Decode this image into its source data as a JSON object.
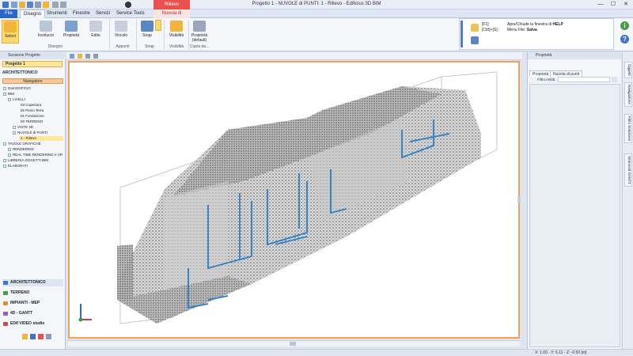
{
  "window": {
    "title": "Progetto 1 - NUVOLE di PUNTI: 1 - Rilievo - Edificius 3D BIM",
    "context_tab_group": "Rilievo",
    "minimize": "—",
    "maximize": "☐",
    "close": "✕"
  },
  "tabs": [
    "File",
    "Disegno",
    "Strumenti",
    "Finestre",
    "Servizi",
    "Service Tools",
    "Nuvola di punti"
  ],
  "ribbon": {
    "select": "Select",
    "involucro": "Involucro",
    "proprieta": "Proprietà",
    "edito": "Edito",
    "vincolo": "Vincolo",
    "snap": "Snap",
    "visibilita": "Visibilità",
    "proprieta_default": "Proprietà (default)",
    "groups": [
      "Disegno",
      "Appunti",
      "Snap",
      "Visibilità",
      "Copia da..."
    ]
  },
  "help": {
    "f1_key": "[F1]",
    "f1_text": "Apre/Chiude la finestra di",
    "f1_bold": "HELP",
    "ctrl_key": "[Ctrl]+[S]",
    "ctrl_text": "Menu File:",
    "ctrl_bold": "Salva"
  },
  "left_panel": {
    "header": "Sessione Progetto",
    "project": "Progetto 1",
    "section": "ARCHITETTONICO",
    "navigator": "Navigatore",
    "tree": [
      "Dati EDIFICIO",
      "BIM",
      "LIVELLI",
      "03 Copertura",
      "02 Piano Terra",
      "01 Fondazione",
      "00 TERRENO",
      "VISTE 3D",
      "NUVOLE di PUNTI",
      "1 - Rilievo",
      "TAVOLE GRAFICHE",
      "RENDERING",
      "REAL TIME RENDERING e VR",
      "LIBRERIA OGGETTI BIM",
      "ELABORATI"
    ],
    "bottom_menu": [
      {
        "label": "ARCHITETTONICO",
        "color": "#3f74c9"
      },
      {
        "label": "TERRENO",
        "color": "#4a9b4a"
      },
      {
        "label": "IMPIANTI - MEP",
        "color": "#d98e2f"
      },
      {
        "label": "4D - GANTT",
        "color": "#9a5bb7"
      },
      {
        "label": "EDIf VIDEO studio",
        "color": "#c84b4b"
      }
    ]
  },
  "right_panel": {
    "header": "Proprietà",
    "tabs": [
      "Proprietà",
      "Nuvola di punti"
    ],
    "filter_label": "Filtro entità",
    "filter_value": ""
  },
  "right_sidebar": [
    "Oggetti",
    "Navigazione",
    "Filtro Selezione",
    "Strumenti GANTT"
  ],
  "status": {
    "coords": "X: 1.00 - Y: 6.11 - Z: -0.50 [m]"
  }
}
